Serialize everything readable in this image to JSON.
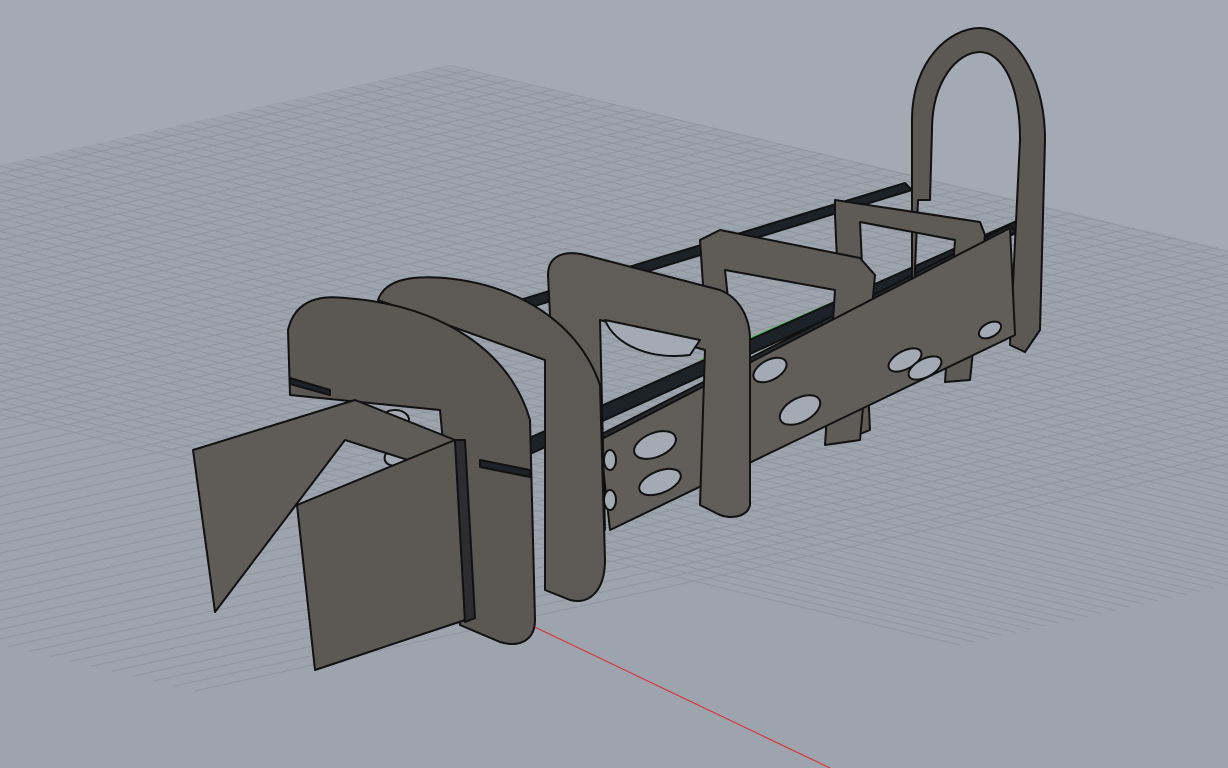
{
  "viewport": {
    "kind": "3D perspective viewport",
    "background_color": "#a3aab3",
    "grid_color": "#8f969f",
    "model_fill": "#5e5b57",
    "model_edge": "#111111",
    "x_axis_color": "#d43a3a",
    "y_axis_color": "#3fbf3f"
  },
  "model": {
    "parts": [
      "front-cross-plate-left",
      "front-cross-plate-right",
      "former-1-rounded",
      "former-2-rounded",
      "former-3-rounded",
      "former-4-rounded",
      "former-5-rounded",
      "former-6-small",
      "tail-arch-former",
      "longerons",
      "side-panels-with-lightening-holes"
    ]
  }
}
